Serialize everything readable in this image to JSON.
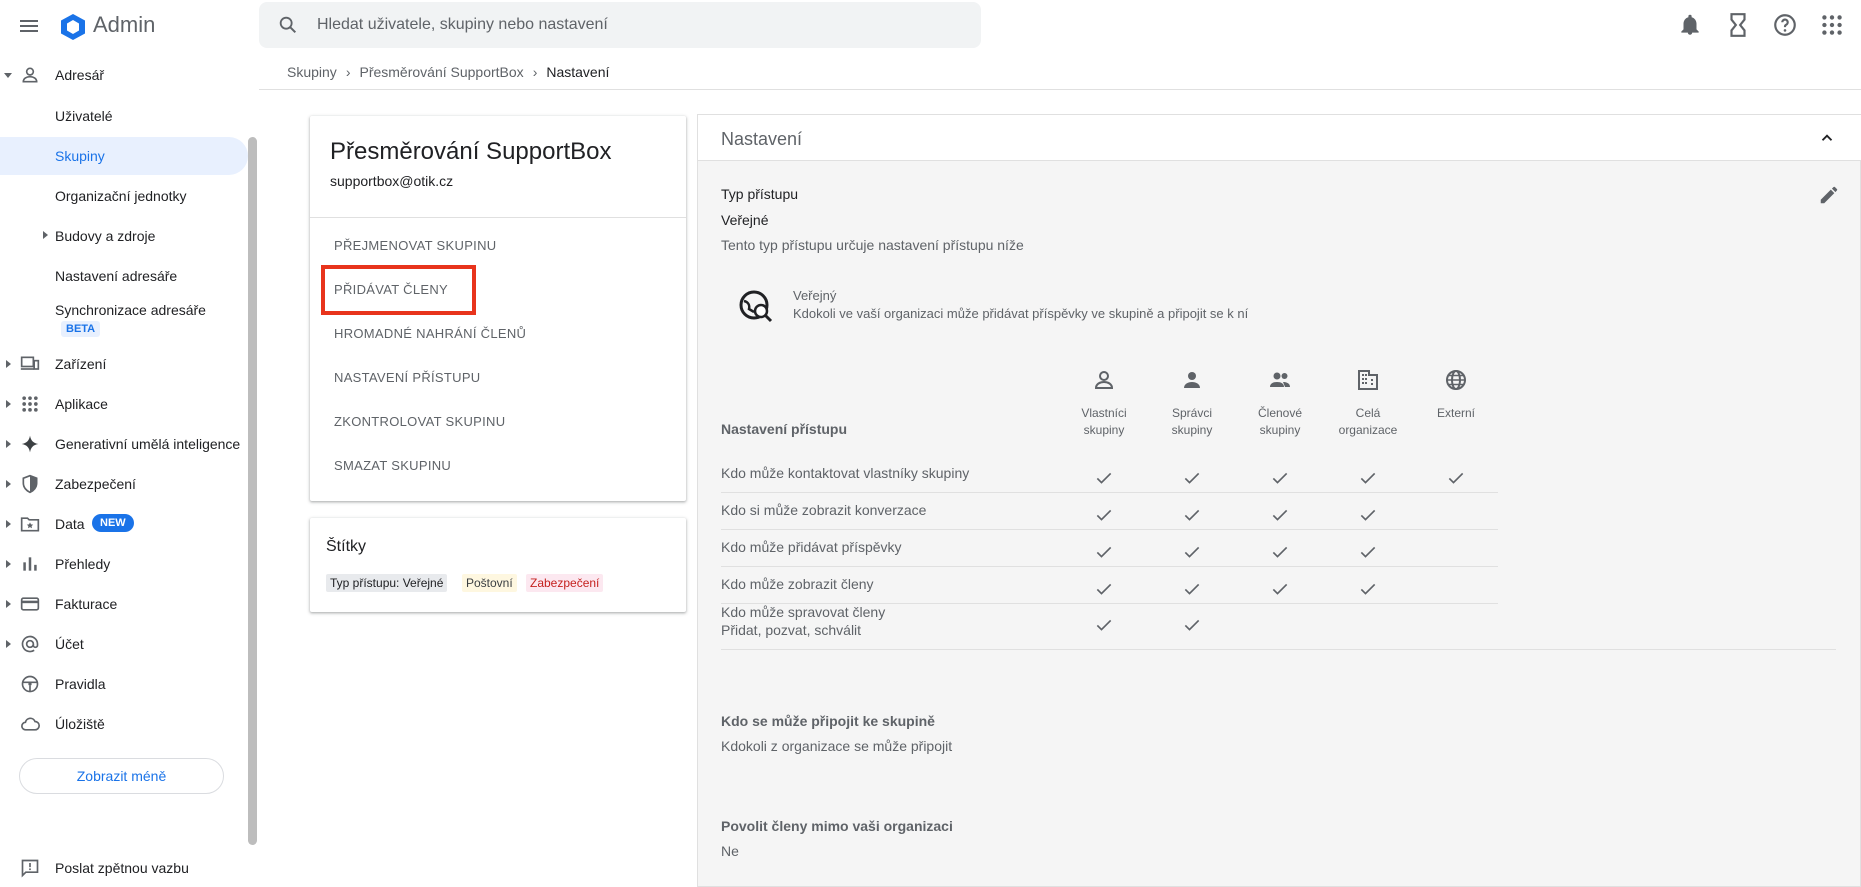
{
  "app": {
    "title": "Admin"
  },
  "search": {
    "placeholder": "Hledat uživatele, skupiny nebo nastavení"
  },
  "sidebar": {
    "directory": "Adresář",
    "users": "Uživatelé",
    "groups": "Skupiny",
    "org_units": "Organizační jednotky",
    "buildings": "Budovy a zdroje",
    "dir_settings": "Nastavení adresáře",
    "dir_sync": "Synchronizace adresáře",
    "beta": "BETA",
    "devices": "Zařízení",
    "apps": "Aplikace",
    "genai": "Generativní umělá inteligence",
    "security": "Zabezpečení",
    "data": "Data",
    "new": "NEW",
    "reports": "Přehledy",
    "billing": "Fakturace",
    "account": "Účet",
    "rules": "Pravidla",
    "storage": "Úložiště",
    "show_less": "Zobrazit méně",
    "feedback": "Poslat zpětnou vazbu"
  },
  "breadcrumb": {
    "groups": "Skupiny",
    "group": "Přesměrování SupportBox",
    "current": "Nastavení"
  },
  "group_card": {
    "name": "Přesměrování SupportBox",
    "email": "supportbox@otik.cz",
    "actions": [
      "PŘEJMENOVAT SKUPINU",
      "PŘIDÁVAT ČLENY",
      "HROMADNÉ NAHRÁNÍ ČLENŮ",
      "NASTAVENÍ PŘÍSTUPU",
      "ZKONTROLOVAT SKUPINU",
      "SMAZAT SKUPINU"
    ]
  },
  "labels_card": {
    "title": "Štítky",
    "chips": [
      "Typ přístupu: Veřejné",
      "Poštovní",
      "Zabezpečení"
    ]
  },
  "settings": {
    "header": "Nastavení",
    "access_type_label": "Typ přístupu",
    "access_type_value": "Veřejné",
    "access_type_desc": "Tento typ přístupu určuje nastavení přístupu níže",
    "public_title": "Veřejný",
    "public_desc": "Kdokoli ve vaší organizaci může přidávat příspěvky ve skupině a připojit se k ní",
    "access_settings": "Nastavení přístupu",
    "columns": [
      {
        "l1": "Vlastníci",
        "l2": "skupiny"
      },
      {
        "l1": "Správci",
        "l2": "skupiny"
      },
      {
        "l1": "Členové",
        "l2": "skupiny"
      },
      {
        "l1": "Celá",
        "l2": "organizace"
      },
      {
        "l1": "Externí",
        "l2": ""
      }
    ],
    "rows": [
      {
        "label": "Kdo může kontaktovat vlastníky skupiny",
        "sub": "",
        "checks": [
          true,
          true,
          true,
          true,
          true
        ]
      },
      {
        "label": "Kdo si může zobrazit konverzace",
        "sub": "",
        "checks": [
          true,
          true,
          true,
          true,
          false
        ]
      },
      {
        "label": "Kdo může přidávat příspěvky",
        "sub": "",
        "checks": [
          true,
          true,
          true,
          true,
          false
        ]
      },
      {
        "label": "Kdo může zobrazit členy",
        "sub": "",
        "checks": [
          true,
          true,
          true,
          true,
          false
        ]
      },
      {
        "label": "Kdo může spravovat členy",
        "sub": "Přidat, pozvat, schválit",
        "checks": [
          true,
          true,
          false,
          false,
          false
        ]
      }
    ],
    "join_title": "Kdo se může připojit ke skupině",
    "join_value": "Kdokoli z organizace se může připojit",
    "external_title": "Povolit členy mimo vaši organizaci",
    "external_value": "Ne"
  }
}
